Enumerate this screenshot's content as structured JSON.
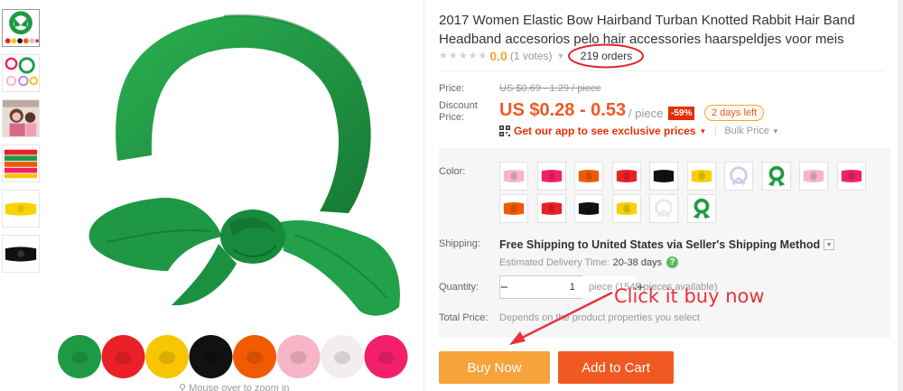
{
  "product": {
    "title": "2017 Women Elastic Bow Hairband Turban Knotted Rabbit Hair Band Headband accesorios pelo hair accessories haarspeldjes voor meis",
    "rating_score": "0.0",
    "rating_votes": "(1 votes)",
    "orders": "219 orders",
    "zoom_hint": "Mouse over to zoom in"
  },
  "pricing": {
    "price_label": "Price:",
    "original_price": "US $0.69 - 1.29 / piece",
    "discount_label": "Discount Price:",
    "discount_price": "US $0.28 - 0.53",
    "unit": "/ piece",
    "discount_pct": "-59%",
    "days_left": "2 days left",
    "app_prompt": "Get our app to see exclusive prices",
    "bulk_price": "Bulk Price"
  },
  "options": {
    "color_label": "Color:",
    "colors": [
      "light pink",
      "rose",
      "orange",
      "red",
      "black",
      "yellow",
      "lavender",
      "green",
      "light pink",
      "rose",
      "orange",
      "red",
      "black",
      "yellow",
      "white",
      "green"
    ],
    "shipping_label": "Shipping:",
    "shipping_method": "Free Shipping to United States via Seller's Shipping Method",
    "delivery_label": "Estimated Delivery Time:",
    "delivery_time": "20-38 days",
    "quantity_label": "Quantity:",
    "quantity_value": "1",
    "quantity_unit": "piece (1545 pieces available)",
    "total_label": "Total Price:",
    "total_note": "Depends on the product properties you select"
  },
  "annotation": {
    "text": "Click it buy now"
  },
  "actions": {
    "buy_now": "Buy Now",
    "add_to_cart": "Add to Cart"
  },
  "gallery": {
    "thumb_count": 6,
    "swatch_colors": [
      "#1e9a45",
      "#ea2027",
      "#f7c600",
      "#111111",
      "#f15a00",
      "#f6b6c8",
      "#f3eded",
      "#f2206a"
    ]
  },
  "colors": {
    "accent": "#f05a22",
    "discount": "#e62e04",
    "buy_now": "#f6a33b",
    "rating": "#f3a33a",
    "product_green": "#1f9a44"
  }
}
